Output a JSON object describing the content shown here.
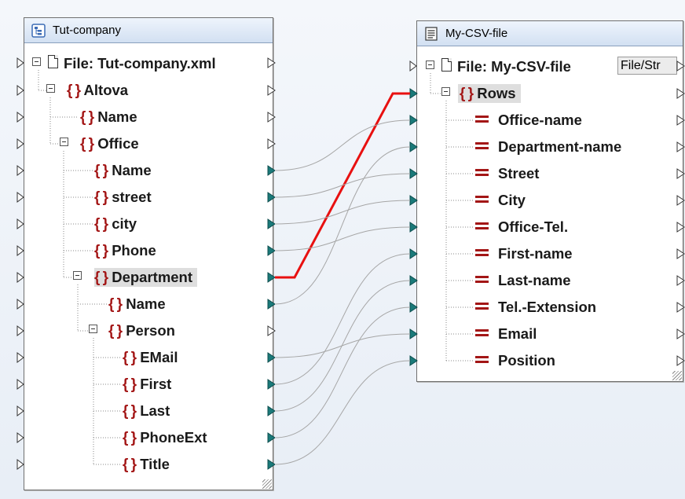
{
  "source_component": {
    "title": "Tut-company",
    "icon": "tree-schema-icon",
    "file_label": "File: Tut-company.xml",
    "items": [
      {
        "label": "Altova",
        "kind": "element"
      },
      {
        "label": "Name",
        "kind": "element"
      },
      {
        "label": "Office",
        "kind": "element"
      },
      {
        "label": "Name",
        "kind": "element"
      },
      {
        "label": "street",
        "kind": "element"
      },
      {
        "label": "city",
        "kind": "element"
      },
      {
        "label": "Phone",
        "kind": "element"
      },
      {
        "label": "Department",
        "kind": "element",
        "highlighted": true
      },
      {
        "label": "Name",
        "kind": "element"
      },
      {
        "label": "Person",
        "kind": "element"
      },
      {
        "label": "EMail",
        "kind": "element"
      },
      {
        "label": "First",
        "kind": "element"
      },
      {
        "label": "Last",
        "kind": "element"
      },
      {
        "label": "PhoneExt",
        "kind": "element"
      },
      {
        "label": "Title",
        "kind": "element"
      }
    ]
  },
  "target_component": {
    "title": "My-CSV-file",
    "icon": "text-file-icon",
    "file_label": "File: My-CSV-file",
    "file_button": "File/Str",
    "rows_label": "Rows",
    "fields": [
      "Office-name",
      "Department-name",
      "Street",
      "City",
      "Office-Tel.",
      "First-name",
      "Last-name",
      "Tel.-Extension",
      "Email",
      "Position"
    ]
  },
  "mappings": [
    {
      "from": "Department",
      "to": "Rows",
      "highlighted": true
    },
    {
      "from": "Name",
      "to": "Office-name"
    },
    {
      "from": "Name (Department)",
      "to": "Department-name"
    },
    {
      "from": "street",
      "to": "Street"
    },
    {
      "from": "city",
      "to": "City"
    },
    {
      "from": "Phone",
      "to": "Office-Tel."
    },
    {
      "from": "First",
      "to": "First-name"
    },
    {
      "from": "Last",
      "to": "Last-name"
    },
    {
      "from": "PhoneExt",
      "to": "Tel.-Extension"
    },
    {
      "from": "EMail",
      "to": "Email"
    },
    {
      "from": "Title",
      "to": "Position"
    }
  ],
  "colors": {
    "highlight_connection": "#e81010",
    "connection": "#a6a6a6",
    "element_icon": "#a31616",
    "connector": "#1b7a7a"
  }
}
